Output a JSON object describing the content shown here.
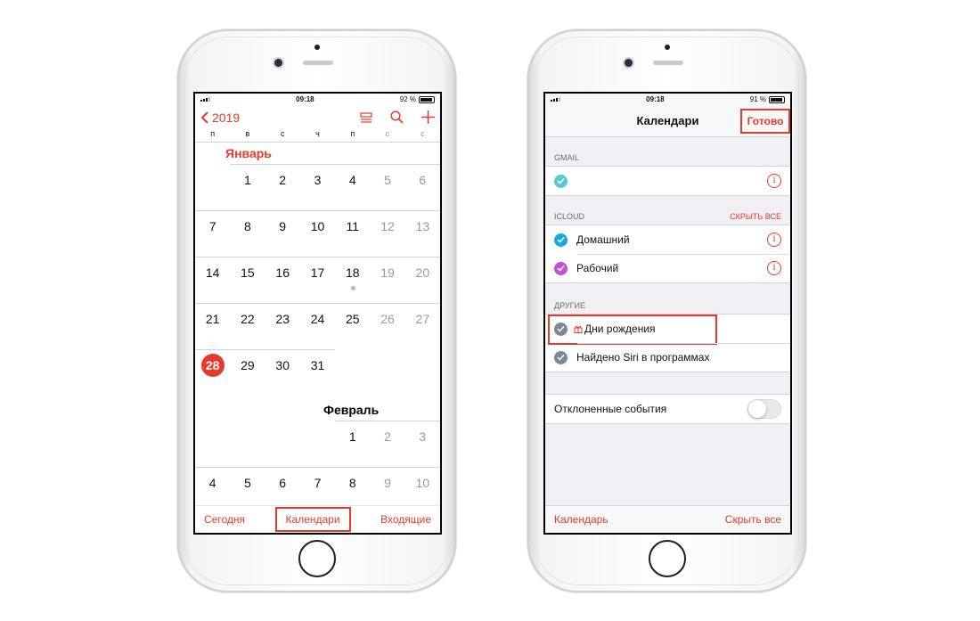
{
  "left": {
    "status": {
      "time": "09:18",
      "battery": "92 %",
      "battery_level": 0.92
    },
    "nav": {
      "back_label": "2019"
    },
    "weekdays": [
      "п",
      "в",
      "с",
      "ч",
      "п",
      "с",
      "с"
    ],
    "january": {
      "title": "Январь",
      "weeks": [
        [
          "",
          "1",
          "2",
          "3",
          "4",
          "5",
          "6"
        ],
        [
          "7",
          "8",
          "9",
          "10",
          "11",
          "12",
          "13"
        ],
        [
          "14",
          "15",
          "16",
          "17",
          "18",
          "19",
          "20"
        ],
        [
          "21",
          "22",
          "23",
          "24",
          "25",
          "26",
          "27"
        ],
        [
          "28",
          "29",
          "30",
          "31",
          "",
          "",
          ""
        ]
      ],
      "today": "28"
    },
    "february": {
      "title": "Февраль",
      "weeks": [
        [
          "",
          "",
          "",
          "",
          "1",
          "2",
          "3"
        ],
        [
          "4",
          "5",
          "6",
          "7",
          "8",
          "9",
          "10"
        ]
      ]
    },
    "tabbar": {
      "today": "Сегодня",
      "calendars": "Календари",
      "inbox": "Входящие"
    }
  },
  "right": {
    "status": {
      "time": "09:18",
      "battery": "91 %",
      "battery_level": 0.91
    },
    "nav": {
      "title": "Календари",
      "done": "Готово"
    },
    "gmail": {
      "header": "GMAIL",
      "color": "#5ac8cf"
    },
    "icloud": {
      "header": "ICLOUD",
      "hide_all": "СКРЫТЬ ВСЕ",
      "items": [
        {
          "label": "Домашний",
          "color": "#1ba8e0"
        },
        {
          "label": "Рабочий",
          "color": "#c54fd6"
        }
      ]
    },
    "other": {
      "header": "ДРУГИЕ",
      "items": [
        {
          "label": "Дни рождения",
          "color": "#7d879a"
        },
        {
          "label": "Найдено Siri в программах",
          "color": "#7d879a"
        }
      ]
    },
    "declined": {
      "label": "Отклоненные события"
    },
    "tabbar": {
      "calendar": "Календарь",
      "hide_all": "Скрыть все"
    }
  },
  "colors": {
    "accent": "#e8392d"
  }
}
